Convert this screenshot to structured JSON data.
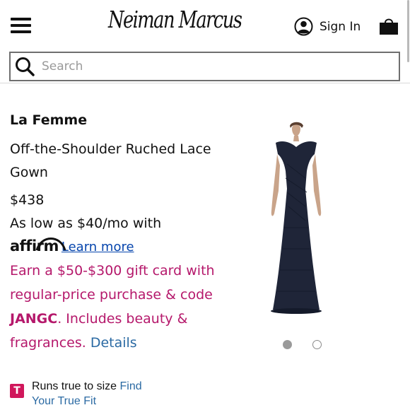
{
  "header": {
    "logo_text": "Neiman Marcus",
    "signin_label": "Sign In",
    "menu_icon": "hamburger-menu-icon",
    "account_icon": "user-circle-icon",
    "bag_icon": "shopping-bag-icon"
  },
  "search": {
    "placeholder": "Search",
    "value": ""
  },
  "product": {
    "brand": "La Femme",
    "name": "Off-the-Shoulder Ruched Lace Gown",
    "price": "$438",
    "financing_text": "As low as $40/mo with",
    "affirm_logo": "affirm",
    "learn_more": "Learn more",
    "promo_lead": "Earn a $50-$300 gift card with regular-price purchase & code ",
    "promo_code": "JANGC",
    "promo_tail": ". Includes beauty & fragrances. ",
    "details_link": "Details",
    "image_count": 2,
    "active_image": 1
  },
  "fit": {
    "badge": "T",
    "text": "Runs true to size ",
    "link": "Find Your True Fit"
  },
  "colors": {
    "promo": "#b5186b",
    "link": "#2b6aa3",
    "affirm_link": "#0645ad",
    "fit_badge": "#d0175b",
    "gown": "#1f2538"
  }
}
